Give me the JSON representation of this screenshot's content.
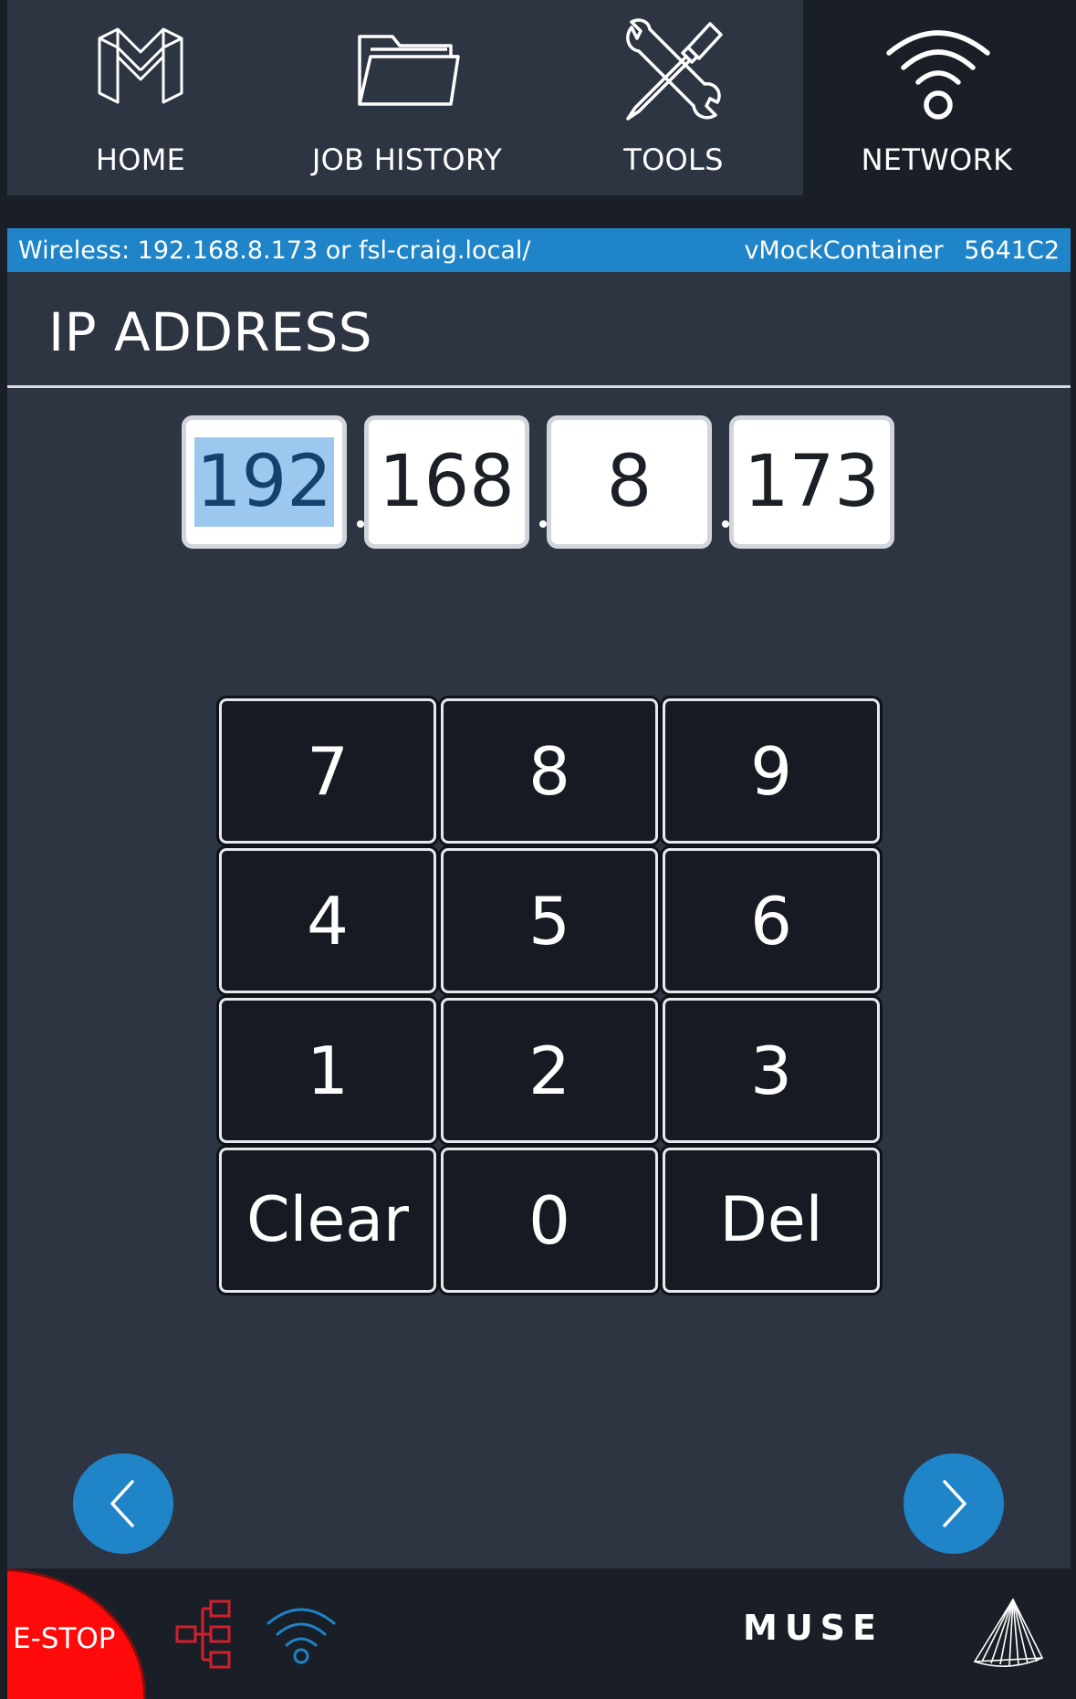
{
  "nav": {
    "tabs": [
      {
        "label": "HOME",
        "icon": "home-logo-icon"
      },
      {
        "label": "JOB HISTORY",
        "icon": "folder-icon"
      },
      {
        "label": "TOOLS",
        "icon": "tools-icon"
      },
      {
        "label": "NETWORK",
        "icon": "wifi-icon",
        "active": true
      }
    ]
  },
  "status": {
    "wireless": "Wireless: 192.168.8.173  or fsl-craig.local/",
    "device": "vMockContainer",
    "serial": "5641C2"
  },
  "page": {
    "title": "IP ADDRESS"
  },
  "ip": {
    "octets": [
      "192",
      "168",
      "8",
      "173"
    ],
    "selected_index": 0
  },
  "keypad": {
    "keys": [
      "7",
      "8",
      "9",
      "4",
      "5",
      "6",
      "1",
      "2",
      "3",
      "Clear",
      "0",
      "Del"
    ]
  },
  "footer": {
    "estop_label": "E-STOP",
    "brand": "MUSE"
  },
  "colors": {
    "accent": "#1f84c8",
    "background": "#2e3542",
    "estop": "#ff0a0a",
    "selection": "#9cc7ee"
  }
}
